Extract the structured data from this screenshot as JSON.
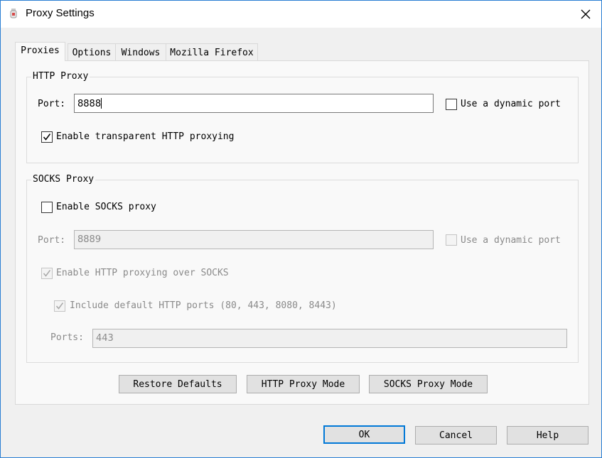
{
  "window": {
    "title": "Proxy Settings"
  },
  "tabs": [
    {
      "label": "Proxies",
      "active": true
    },
    {
      "label": "Options",
      "active": false
    },
    {
      "label": "Windows",
      "active": false
    },
    {
      "label": "Mozilla Firefox",
      "active": false
    }
  ],
  "http_proxy": {
    "group_title": "HTTP Proxy",
    "port_label": "Port:",
    "port_value": "8888",
    "dynamic_port_label": "Use a dynamic port",
    "dynamic_port_checked": false,
    "transparent_label": "Enable transparent HTTP proxying",
    "transparent_checked": true
  },
  "socks_proxy": {
    "group_title": "SOCKS Proxy",
    "enable_label": "Enable SOCKS proxy",
    "enable_checked": false,
    "port_label": "Port:",
    "port_value": "8889",
    "dynamic_port_label": "Use a dynamic port",
    "dynamic_port_checked": false,
    "http_over_socks_label": "Enable HTTP proxying over SOCKS",
    "http_over_socks_checked": true,
    "include_default_label": "Include default HTTP ports (80, 443, 8080, 8443)",
    "include_default_checked": true,
    "ports_label": "Ports:",
    "ports_value": "443"
  },
  "mode_buttons": {
    "restore": "Restore Defaults",
    "http_mode": "HTTP Proxy Mode",
    "socks_mode": "SOCKS Proxy Mode"
  },
  "dialog_buttons": {
    "ok": "OK",
    "cancel": "Cancel",
    "help": "Help"
  },
  "colors": {
    "accent": "#0078d7",
    "window_border": "#2b7fd4",
    "disabled_text": "#8a8a8a"
  }
}
